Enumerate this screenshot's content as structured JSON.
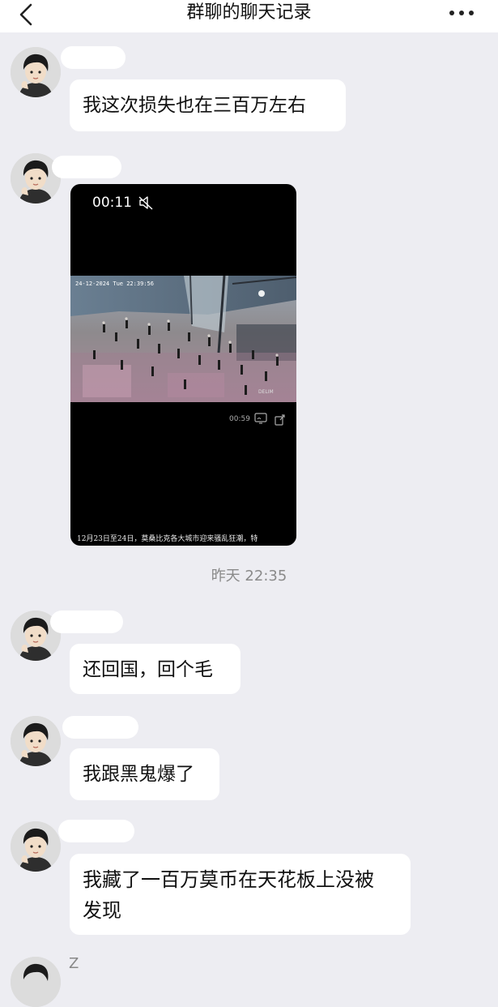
{
  "header": {
    "title": "群聊的聊天记录"
  },
  "messages": [
    {
      "nickname": "",
      "text": "我这次损失也在三百万左右"
    },
    {
      "nickname": "",
      "video": {
        "elapsed": "00:11",
        "duration": "00:59",
        "frame_timestamp": "24-12-2024 Tue 22:39:56",
        "frame_watermark": "DELIM",
        "caption": "12月23日至24日，莫桑比克各大城市迎来骚乱狂潮，特"
      }
    },
    {
      "timestamp": "昨天 22:35"
    },
    {
      "nickname": "",
      "text": "还回国，回个毛"
    },
    {
      "nickname": "",
      "text": "我跟黑鬼爆了"
    },
    {
      "nickname": "",
      "text": "我藏了一百万莫币在天花板上没被\n发现"
    },
    {
      "nickname": "Z"
    }
  ],
  "icons": {
    "back": "chevron-left-icon",
    "more": "more-dots-icon",
    "mute": "speaker-muted-icon",
    "cast": "cast-icon",
    "share": "share-icon"
  },
  "colors": {
    "background": "#ededf2",
    "bubble": "#ffffff",
    "header": "#ffffff",
    "timestamp_text": "#8a8a8a"
  }
}
